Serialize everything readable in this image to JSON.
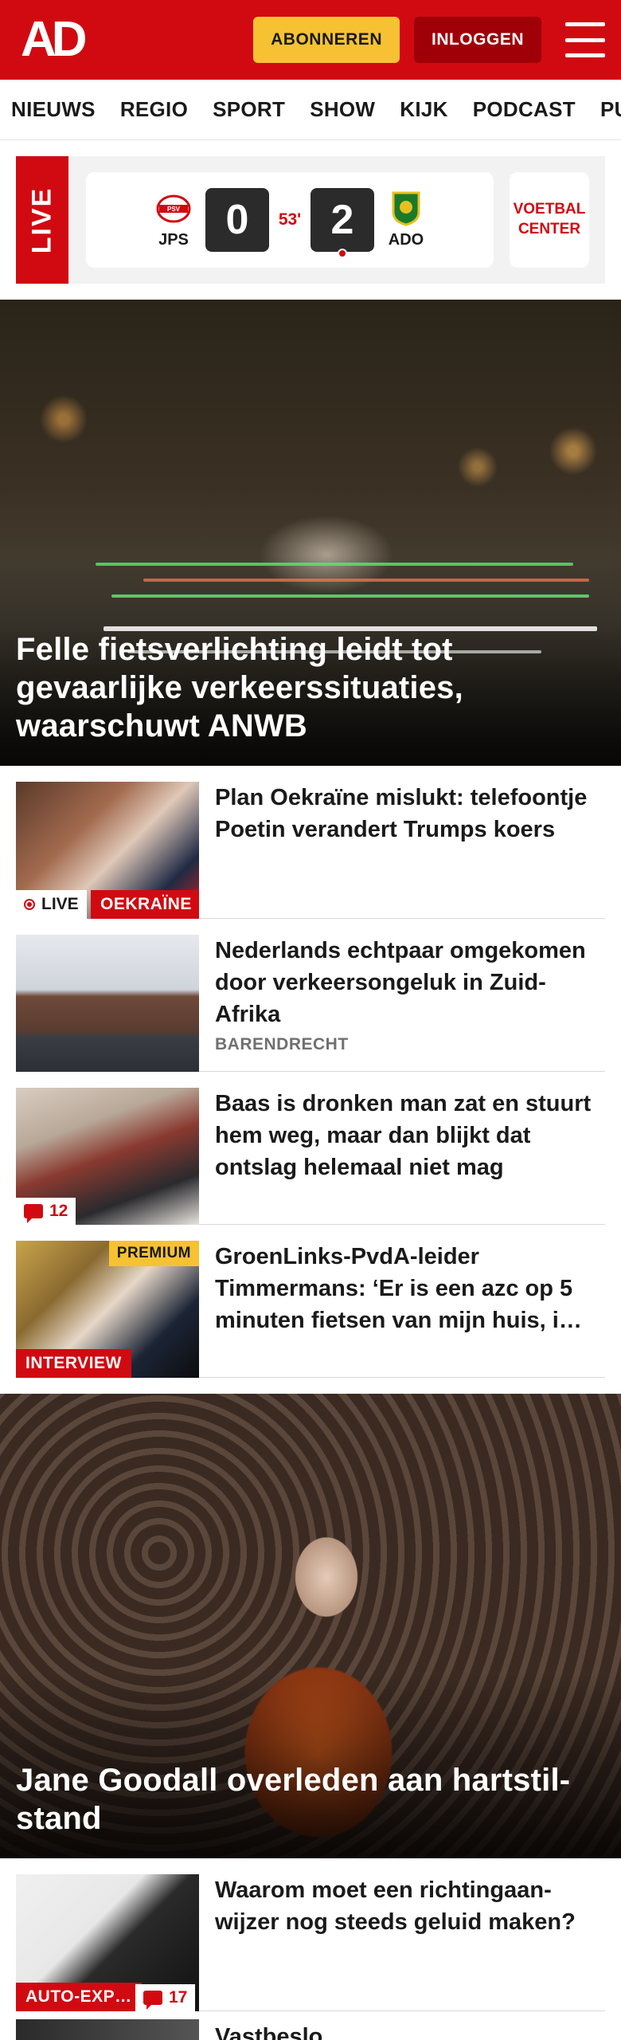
{
  "header": {
    "logo": "AD",
    "subscribe_label": "ABONNEREN",
    "login_label": "INLOGGEN",
    "menu_icon": "hamburger-menu-icon",
    "brand_color": "#d10a11",
    "subscribe_color": "#f6c234"
  },
  "nav": {
    "items": [
      "NIEUWS",
      "REGIO",
      "SPORT",
      "SHOW",
      "KIJK",
      "PODCAST",
      "PUZZ"
    ]
  },
  "live": {
    "label": "LIVE",
    "home_team": "JPS",
    "home_logo": "psv-crest-icon",
    "home_score": "0",
    "minute": "53'",
    "away_score": "2",
    "away_team": "ADO",
    "away_logo": "ado-crest-icon",
    "football_center": "VOETBAL CENTER"
  },
  "hero1": {
    "title": "Felle fietsverlichting leidt tot gevaarlijke verkeerssituaties, waarschuwt ANWB"
  },
  "list1": [
    {
      "title": "Plan Oekraïne mislukt: telefoon­tje Poetin verandert Trumps koers",
      "live_label": "LIVE",
      "tag": "OEKRAÏNE"
    },
    {
      "title": "Nederlands echtpaar omgekomen door verkeersonge­luk in Zuid-Afrika",
      "location": "BARENDRECHT"
    },
    {
      "title": "Baas is dronken man zat en stuurt hem weg, maar dan blijkt dat ontslag helemaal niet mag",
      "comments": "12"
    },
    {
      "title": "GroenLinks-PvdA-leider Timmermans: ‘Er is een azc op 5 minuten fietsen van mijn huis, i…",
      "premium": "PREMIUM",
      "tag": "INTERVIEW"
    }
  ],
  "hero2": {
    "title": "Jane Goodall overleden aan hartstil­stand"
  },
  "list2": [
    {
      "title": "Waarom moet een richtingaan­wijzer nog steeds geluid maken?",
      "tag": "AUTO-EXP…",
      "comments": "17"
    }
  ],
  "peek": {
    "title": "Vastbeslo…"
  }
}
